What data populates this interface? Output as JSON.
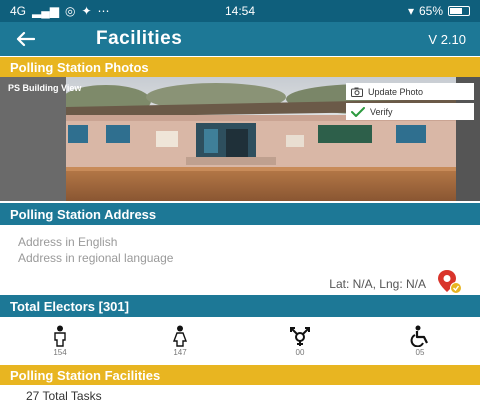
{
  "status_bar": {
    "network": "4G",
    "time": "14:54",
    "battery": "65%"
  },
  "app_bar": {
    "title": "Facilities",
    "version": "V 2.10"
  },
  "photos": {
    "section_title": "Polling Station Photos",
    "caption": "PS Building View",
    "update_label": "Update Photo",
    "verify_label": "Verify"
  },
  "address": {
    "section_title": "Polling Station Address",
    "english_placeholder": "Address in English",
    "regional_placeholder": "Address in regional language",
    "latlng": "Lat: N/A, Lng: N/A"
  },
  "electors": {
    "section_title": "Total Electors [301]",
    "items": [
      {
        "icon": "male-icon",
        "count": "154"
      },
      {
        "icon": "female-icon",
        "count": "147"
      },
      {
        "icon": "third-gender-icon",
        "count": "00"
      },
      {
        "icon": "pwd-wheelchair-icon",
        "count": "05"
      }
    ]
  },
  "facilities": {
    "section_title": "Polling Station Facilities",
    "tasks": "27 Total Tasks"
  },
  "colors": {
    "primary": "#1d7896",
    "status": "#0f5f7c",
    "accent": "#e8b521",
    "pin": "#d9342b"
  }
}
